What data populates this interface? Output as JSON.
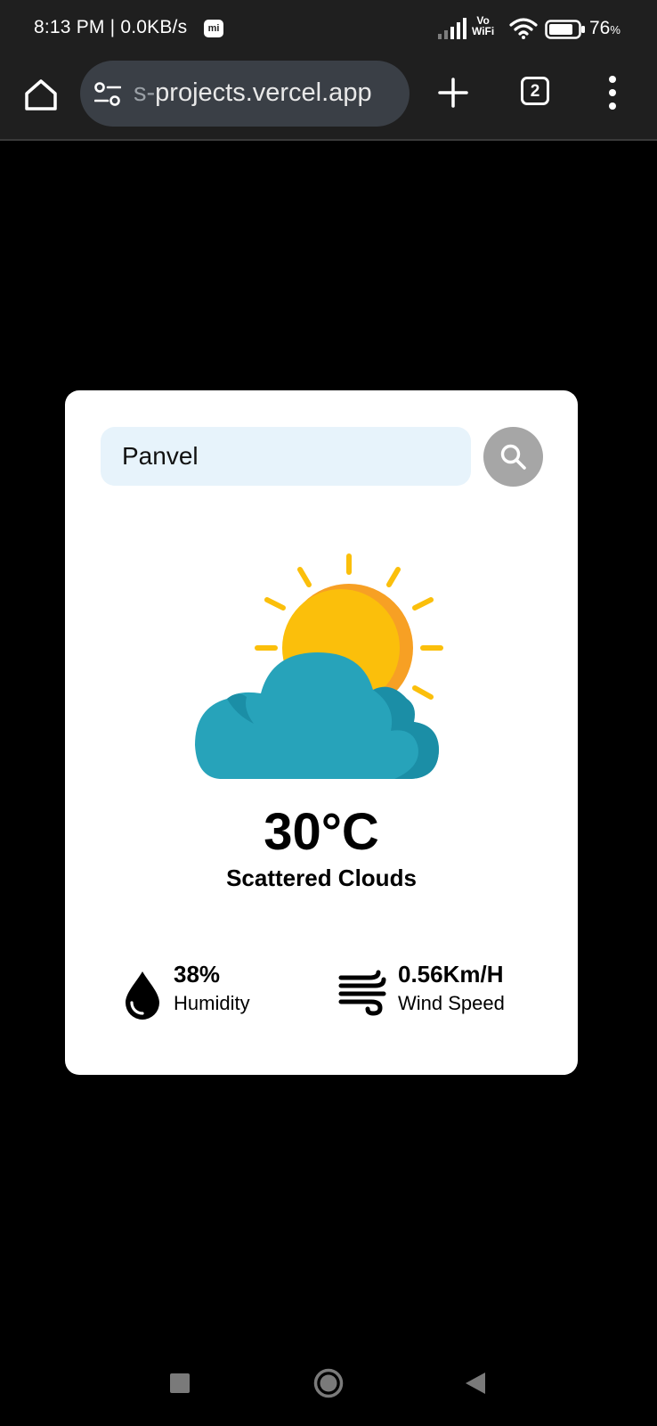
{
  "status_bar": {
    "time": "8:13 PM | 0.0KB/s",
    "mi_badge": "mi",
    "vowifi_top": "Vo",
    "vowifi_bottom": "WiFi",
    "battery_level": "76",
    "battery_unit": "%",
    "icons": [
      "signal-icon",
      "wifi-icon",
      "battery-icon"
    ]
  },
  "browser": {
    "url_prefix": "s-",
    "url_main": "projects.vercel.app",
    "tab_count": "2",
    "icons": [
      "home-icon",
      "tune-icon",
      "plus-icon",
      "more-vert-icon"
    ]
  },
  "weather": {
    "search": {
      "value": "Panvel",
      "placeholder": ""
    },
    "temperature": "30°C",
    "description": "Scattered Clouds",
    "humidity": {
      "value": "38%",
      "label": "Humidity"
    },
    "wind": {
      "value": "0.56Km/H",
      "label": "Wind Speed"
    },
    "icon": "sun-behind-cloud-icon"
  },
  "colors": {
    "background": "#000000",
    "card": "#ffffff",
    "search_field": "#e7f3fb",
    "search_button": "#a6a6a6",
    "sun": "#fbbf0b",
    "sun_shade": "#f7a024",
    "cloud": "#27a3ba",
    "cloud_shade": "#1b8ea6",
    "chrome_bar": "#1f1f1f"
  },
  "nav_bar": {
    "icons": [
      "recent-apps-icon",
      "home-circle-icon",
      "back-icon"
    ]
  }
}
